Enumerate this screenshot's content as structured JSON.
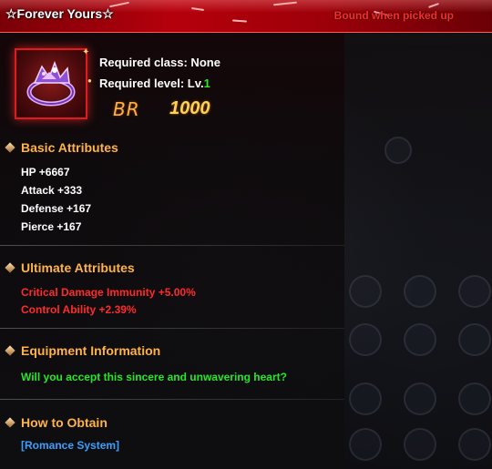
{
  "header": {
    "title": "☆Forever Yours☆",
    "bound_text": "Bound when picked up"
  },
  "item": {
    "icon": "ring-icon",
    "required_class_label": "Required class: None",
    "required_level_label": "Required level: Lv.",
    "required_level_value": "1",
    "br_label": "BR",
    "br_value": "1000"
  },
  "sections": {
    "basic": {
      "title": "Basic Attributes",
      "stats": [
        "HP +6667",
        "Attack +333",
        "Defense +167",
        "Pierce +167"
      ]
    },
    "ultimate": {
      "title": "Ultimate Attributes",
      "stats": [
        "Critical Damage Immunity +5.00%",
        "Control Ability +2.39%"
      ]
    },
    "equipment": {
      "title": "Equipment Information",
      "description": "Will you accept this sincere and unwavering heart?"
    },
    "obtain": {
      "title": "How to Obtain",
      "source": "[Romance System]"
    }
  },
  "colors": {
    "header_red": "#b5000c",
    "section_title": "#ffb347",
    "ultimate_red": "#ff2b2b",
    "flavor_green": "#27e627",
    "link_blue": "#3aa0ff",
    "level_green": "#2ee82e",
    "br_gold": "#ffd256"
  }
}
